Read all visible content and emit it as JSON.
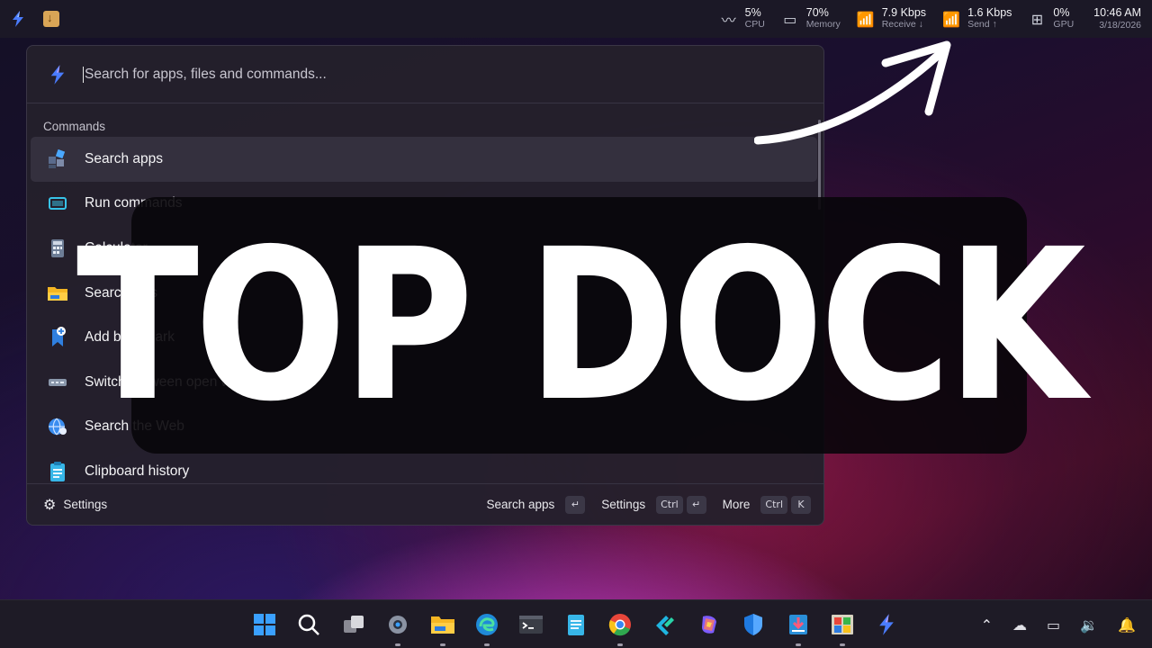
{
  "topdock": {
    "metrics": [
      {
        "icon": "activity-icon",
        "value": "5%",
        "label": "CPU"
      },
      {
        "icon": "memory-icon",
        "value": "70%",
        "label": "Memory"
      },
      {
        "icon": "antenna-icon",
        "value": "7.9 Kbps",
        "label": "Receive ↓"
      },
      {
        "icon": "antenna-icon",
        "value": "1.6 Kbps",
        "label": "Send ↑"
      },
      {
        "icon": "chip-icon",
        "value": "0%",
        "label": "GPU"
      }
    ],
    "time": "10:46 AM",
    "date": "3/18/2026"
  },
  "launcher": {
    "search_placeholder": "Search for apps, files and commands...",
    "section": "Commands",
    "items": [
      {
        "label": "Search apps",
        "icon": "apps-icon"
      },
      {
        "label": "Run commands",
        "icon": "terminal-icon"
      },
      {
        "label": "Calculator",
        "icon": "calculator-icon"
      },
      {
        "label": "Search files",
        "icon": "folder-icon"
      },
      {
        "label": "Add bookmark",
        "icon": "bookmark-icon"
      },
      {
        "label": "Switch between open windows",
        "icon": "window-switch-icon"
      },
      {
        "label": "Search the Web",
        "icon": "globe-icon"
      },
      {
        "label": "Clipboard history",
        "icon": "clipboard-icon"
      }
    ],
    "footer": {
      "settings_label": "Settings",
      "hints": [
        {
          "label": "Search apps",
          "keys": [
            "↵"
          ]
        },
        {
          "label": "Settings",
          "keys": [
            "Ctrl",
            "↵"
          ]
        },
        {
          "label": "More",
          "keys": [
            "Ctrl",
            "K"
          ]
        }
      ]
    }
  },
  "overlay": {
    "title": "TOP DOCK"
  },
  "taskbar": {
    "icons": [
      "windows-start-icon",
      "search-icon",
      "task-view-icon",
      "settings-icon",
      "file-explorer-icon",
      "edge-icon",
      "terminal-icon",
      "notepad-icon",
      "chrome-icon",
      "app-icon",
      "copilot-icon",
      "defender-icon",
      "downloader-icon",
      "app-store-icon",
      "top-dock-icon"
    ],
    "tray": [
      "chevron-up-icon",
      "onedrive-icon",
      "network-icon",
      "volume-icon",
      "notifications-icon"
    ]
  }
}
